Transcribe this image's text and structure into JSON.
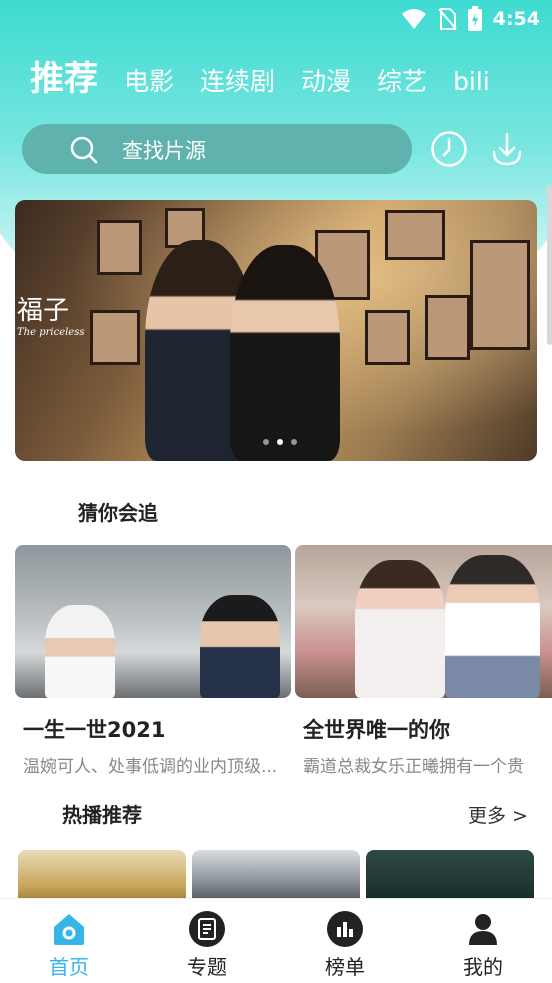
{
  "status_bar": {
    "time": "4:54"
  },
  "nav": {
    "tabs": [
      {
        "label": "推荐",
        "active": true
      },
      {
        "label": "电影"
      },
      {
        "label": "连续剧"
      },
      {
        "label": "动漫"
      },
      {
        "label": "综艺"
      },
      {
        "label": "bili"
      }
    ]
  },
  "search": {
    "placeholder": "查找片源"
  },
  "banner": {
    "caption": "福子",
    "caption_sub": "The priceless",
    "dots": 3,
    "active_dot": 1
  },
  "guess": {
    "title": "猜你会追",
    "cards": [
      {
        "title": "一生一世2021",
        "desc": "温婉可人、处事低调的业内顶级..."
      },
      {
        "title": "全世界唯一的你",
        "desc": "霸道总裁女乐正曦拥有一个贵"
      }
    ]
  },
  "hot": {
    "title": "热播推荐",
    "more": "更多 >"
  },
  "bottom_nav": [
    {
      "label": "首页",
      "icon": "home-icon",
      "active": true
    },
    {
      "label": "专题",
      "icon": "topic-icon"
    },
    {
      "label": "榜单",
      "icon": "chart-icon"
    },
    {
      "label": "我的",
      "icon": "user-icon"
    }
  ],
  "colors": {
    "accent": "#35b5e8",
    "header": "#3ddbd1",
    "search_bg": "#5fb2ad"
  }
}
